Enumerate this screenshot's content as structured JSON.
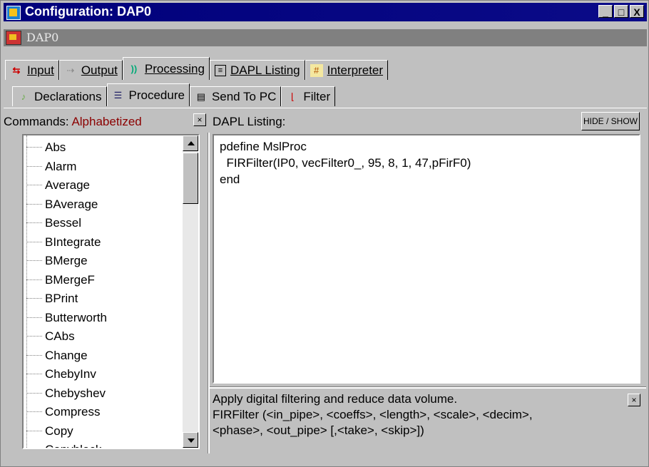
{
  "window": {
    "title": "Configuration: DAP0",
    "subtitle": "DAP0"
  },
  "title_buttons": {
    "minimize": "_",
    "maximize": "□",
    "close": "X"
  },
  "main_tabs": [
    {
      "label": "Input",
      "icon": "input-icon"
    },
    {
      "label": "Output",
      "icon": "output-icon"
    },
    {
      "label": "Processing",
      "icon": "processing-icon"
    },
    {
      "label": "DAPL Listing",
      "icon": "listing-icon"
    },
    {
      "label": "Interpreter",
      "icon": "interpreter-icon"
    }
  ],
  "sub_tabs": [
    {
      "label": "Declarations",
      "icon": "declarations-icon"
    },
    {
      "label": "Procedure",
      "icon": "procedure-icon"
    },
    {
      "label": "Send To PC",
      "icon": "send-to-pc-icon"
    },
    {
      "label": "Filter",
      "icon": "filter-icon"
    }
  ],
  "commands": {
    "label": "Commands:",
    "mode": "Alphabetized",
    "items": [
      "Abs",
      "Alarm",
      "Average",
      "BAverage",
      "Bessel",
      "BIntegrate",
      "BMerge",
      "BMergeF",
      "BPrint",
      "Butterworth",
      "CAbs",
      "Change",
      "ChebyInv",
      "Chebyshev",
      "Compress",
      "Copy",
      "Copyblock"
    ]
  },
  "dapl": {
    "label": "DAPL Listing:",
    "hide_show": "HIDE / SHOW",
    "lines": [
      "pdefine MslProc",
      "  FIRFilter(IP0, vecFilter0_, 95, 8, 1, 47,pFirF0)",
      "end"
    ]
  },
  "help": {
    "line1": "Apply digital filtering and reduce data volume.",
    "line2": "FIRFilter (<in_pipe>, <coeffs>, <length>, <scale>, <decim>,",
    "line3": "<phase>, <out_pipe> [,<take>, <skip>])"
  },
  "close_glyph": "×"
}
